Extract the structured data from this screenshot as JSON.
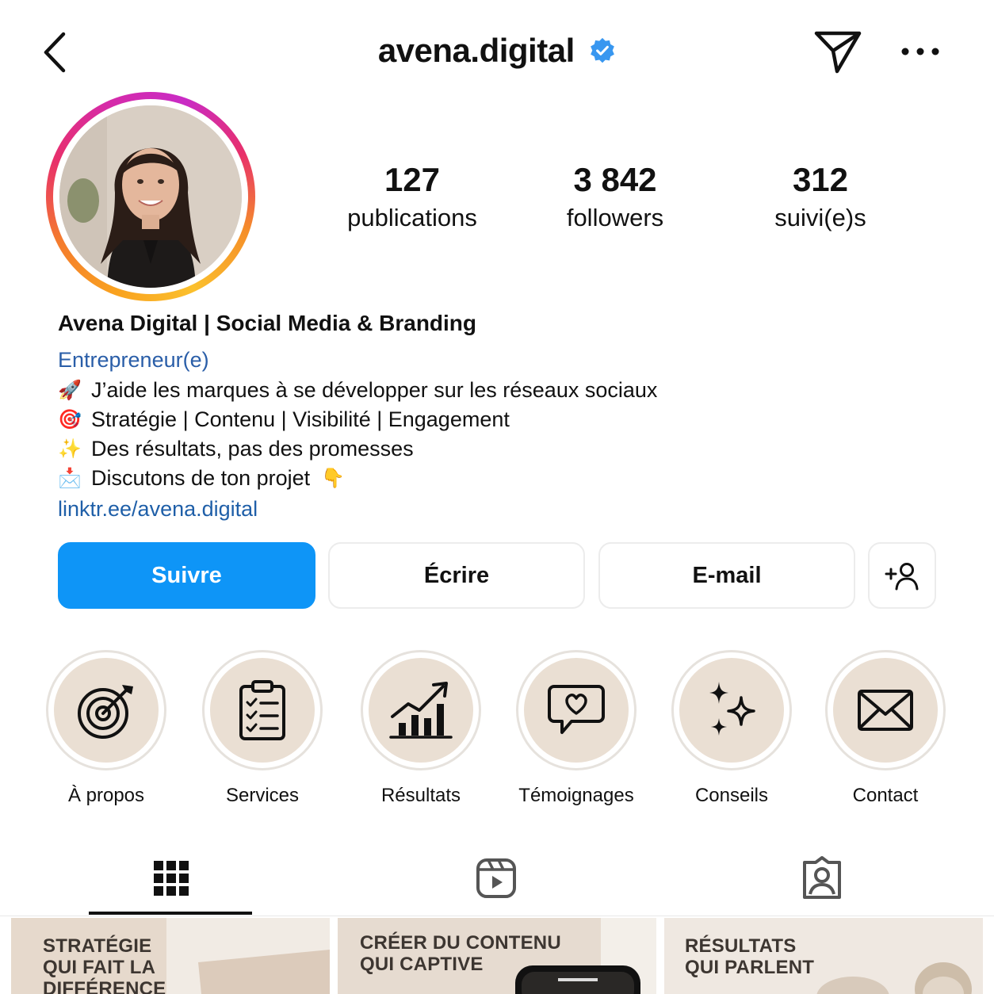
{
  "header": {
    "username": "avena.digital",
    "back_icon": "chevron-left-icon",
    "verified_icon": "verified-badge-icon",
    "send_icon": "paper-plane-icon",
    "more_icon": "more-horizontal-icon",
    "verified_color": "#3897f0"
  },
  "stats": [
    {
      "value": "127",
      "label": "publications"
    },
    {
      "value": "3 842",
      "label": "followers"
    },
    {
      "value": "312",
      "label": "suivi(e)s"
    }
  ],
  "bio": {
    "name": "Avena Digital | Social Media & Branding",
    "category": "Entrepreneur(e)",
    "lines": [
      {
        "emoji": "🚀",
        "text": "J’aide les marques à se développer sur les réseaux sociaux"
      },
      {
        "emoji": "🎯",
        "text": "Stratégie | Contenu | Visibilité | Engagement"
      },
      {
        "emoji": "✨",
        "text": "Des résultats, pas des promesses"
      },
      {
        "emoji": "📩",
        "text": "Discutons de ton projet",
        "trailing_emoji": "👇"
      }
    ],
    "link": "linktr.ee/avena.digital"
  },
  "actions": {
    "follow": "Suivre",
    "message": "Écrire",
    "email": "E-mail",
    "add_user_icon": "add-user-icon",
    "follow_color": "#0e95f7"
  },
  "highlights": [
    {
      "label": "À propos",
      "icon": "target-icon"
    },
    {
      "label": "Services",
      "icon": "clipboard-checklist-icon"
    },
    {
      "label": "Résultats",
      "icon": "growth-chart-icon"
    },
    {
      "label": "Témoignages",
      "icon": "heart-chat-icon"
    },
    {
      "label": "Conseils",
      "icon": "sparkles-icon"
    },
    {
      "label": "Contact",
      "icon": "envelope-icon"
    }
  ],
  "tabs": [
    {
      "name": "grid",
      "icon": "grid-icon",
      "active": true
    },
    {
      "name": "reels",
      "icon": "reels-icon",
      "active": false
    },
    {
      "name": "tagged",
      "icon": "tagged-user-icon",
      "active": false
    }
  ],
  "posts": [
    {
      "title_line1": "STRATÉGIE",
      "title_line2": "QUI FAIT LA",
      "title_line3": "DIFFÉRENCE"
    },
    {
      "title_line1": "CRÉER DU CONTENU",
      "title_line2": "QUI CAPTIVE"
    },
    {
      "title_line1": "RÉSULTATS",
      "title_line2": "QUI PARLENT"
    }
  ],
  "highlight_fill_color": "#eadfd3"
}
